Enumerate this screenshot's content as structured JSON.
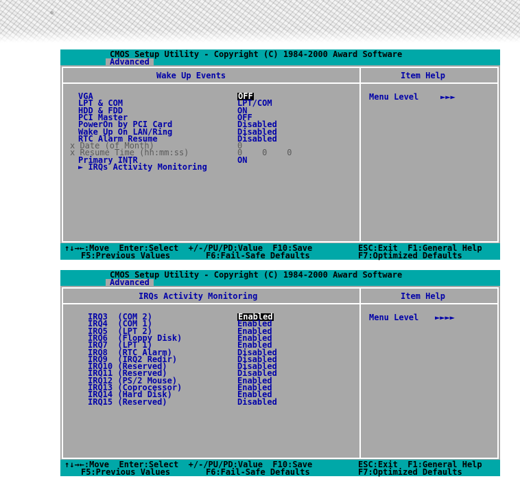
{
  "title": "CMOS Setup Utility - Copyright (C) 1984-2000 Award Software",
  "menu": "Advanced",
  "help_header": "Item Help",
  "footer": {
    "line1_left": "↑↓→←:Move  Enter:Select  +/-/PU/PD:Value  F10:Save",
    "line1_right": "ESC:Exit  F1:General Help",
    "line2_left": "F5:Previous Values",
    "line2_mid": "F6:Fail-Safe Defaults",
    "line2_right": "F7:Optimized Defaults"
  },
  "screen1": {
    "panel_title": "Wake Up Events",
    "help_label": "Menu Level",
    "help_arrows": "►►►",
    "items": [
      {
        "label": "VGA",
        "value": "OFF",
        "selected": true,
        "disabled": false
      },
      {
        "label": "LPT & COM",
        "value": "LPT/COM",
        "selected": false,
        "disabled": false
      },
      {
        "label": "HDD & FDD",
        "value": "ON",
        "selected": false,
        "disabled": false
      },
      {
        "label": "PCI Master",
        "value": "OFF",
        "selected": false,
        "disabled": false
      },
      {
        "label": "PowerOn by PCI Card",
        "value": "Disabled",
        "selected": false,
        "disabled": false
      },
      {
        "label": "Wake Up On LAN/Ring",
        "value": "Disabled",
        "selected": false,
        "disabled": false
      },
      {
        "label": "RTC Alarm Resume",
        "value": "Disabled",
        "selected": false,
        "disabled": false
      },
      {
        "label": "x Date (of Month)",
        "value": "0",
        "selected": false,
        "disabled": true
      },
      {
        "label": "x Resume Time (hh:mm:ss)",
        "value": "0    0    0",
        "selected": false,
        "disabled": true
      },
      {
        "label": "Primary INTR",
        "value": "ON",
        "selected": false,
        "disabled": false
      },
      {
        "label": "► IRQs Activity Monitoring",
        "value": "",
        "selected": false,
        "disabled": false
      }
    ]
  },
  "screen2": {
    "panel_title": "IRQs Activity Monitoring",
    "help_label": "Menu Level",
    "help_arrows": "►►►►",
    "items": [
      {
        "label": "IRQ3  (COM 2)",
        "value": "Enabled",
        "selected": true
      },
      {
        "label": "IRQ4  (COM 1)",
        "value": "Enabled",
        "selected": false
      },
      {
        "label": "IRQ5  (LPT 2)",
        "value": "Enabled",
        "selected": false
      },
      {
        "label": "IRQ6  (Floppy Disk)",
        "value": "Enabled",
        "selected": false
      },
      {
        "label": "IRQ7  (LPT 1)",
        "value": "Enabled",
        "selected": false
      },
      {
        "label": "IRQ8  (RTC Alarm)",
        "value": "Disabled",
        "selected": false
      },
      {
        "label": "IRQ9  (IRQ2 Redir)",
        "value": "Disabled",
        "selected": false
      },
      {
        "label": "IRQ10 (Reserved)",
        "value": "Disabled",
        "selected": false
      },
      {
        "label": "IRQ11 (Reserved)",
        "value": "Disabled",
        "selected": false
      },
      {
        "label": "IRQ12 (PS/2 Mouse)",
        "value": "Enabled",
        "selected": false
      },
      {
        "label": "IRQ13 (Coprocessor)",
        "value": "Enabled",
        "selected": false
      },
      {
        "label": "IRQ14 (Hard Disk)",
        "value": "Enabled",
        "selected": false
      },
      {
        "label": "IRQ15 (Reserved)",
        "value": "Disabled",
        "selected": false
      }
    ]
  }
}
